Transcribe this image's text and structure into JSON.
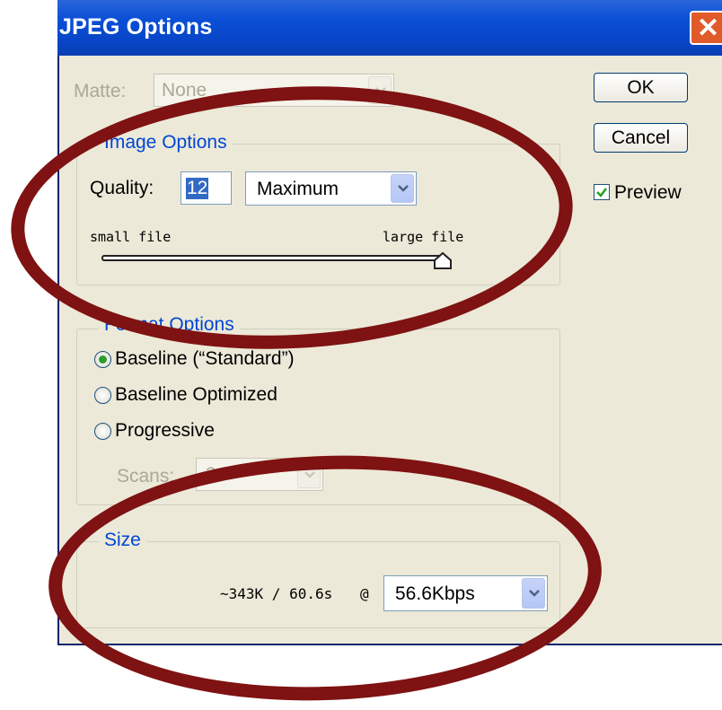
{
  "window": {
    "title": "JPEG Options",
    "close_glyph": "✕"
  },
  "matte": {
    "label": "Matte:",
    "value": "None"
  },
  "image_options": {
    "legend": "Image Options",
    "quality_label": "Quality:",
    "quality_value": "12",
    "quality_preset": "Maximum",
    "slider_min_label": "small file",
    "slider_max_label": "large file",
    "slider_level": 1.0
  },
  "format_options": {
    "legend": "Format Options",
    "options": [
      "Baseline (“Standard”)",
      "Baseline Optimized",
      "Progressive"
    ],
    "selected_index": 0,
    "scans_label": "Scans:",
    "scans_value": "3"
  },
  "size": {
    "legend": "Size",
    "estimate": "~343K / 60.6s",
    "at": "@",
    "connection": "56.6Kbps"
  },
  "buttons": {
    "ok": "OK",
    "cancel": "Cancel"
  },
  "preview": {
    "label": "Preview",
    "checked": true
  },
  "colors": {
    "title_bar": "#0a4fd6",
    "annotation": "#7f1212",
    "accent": "#0046d5"
  }
}
